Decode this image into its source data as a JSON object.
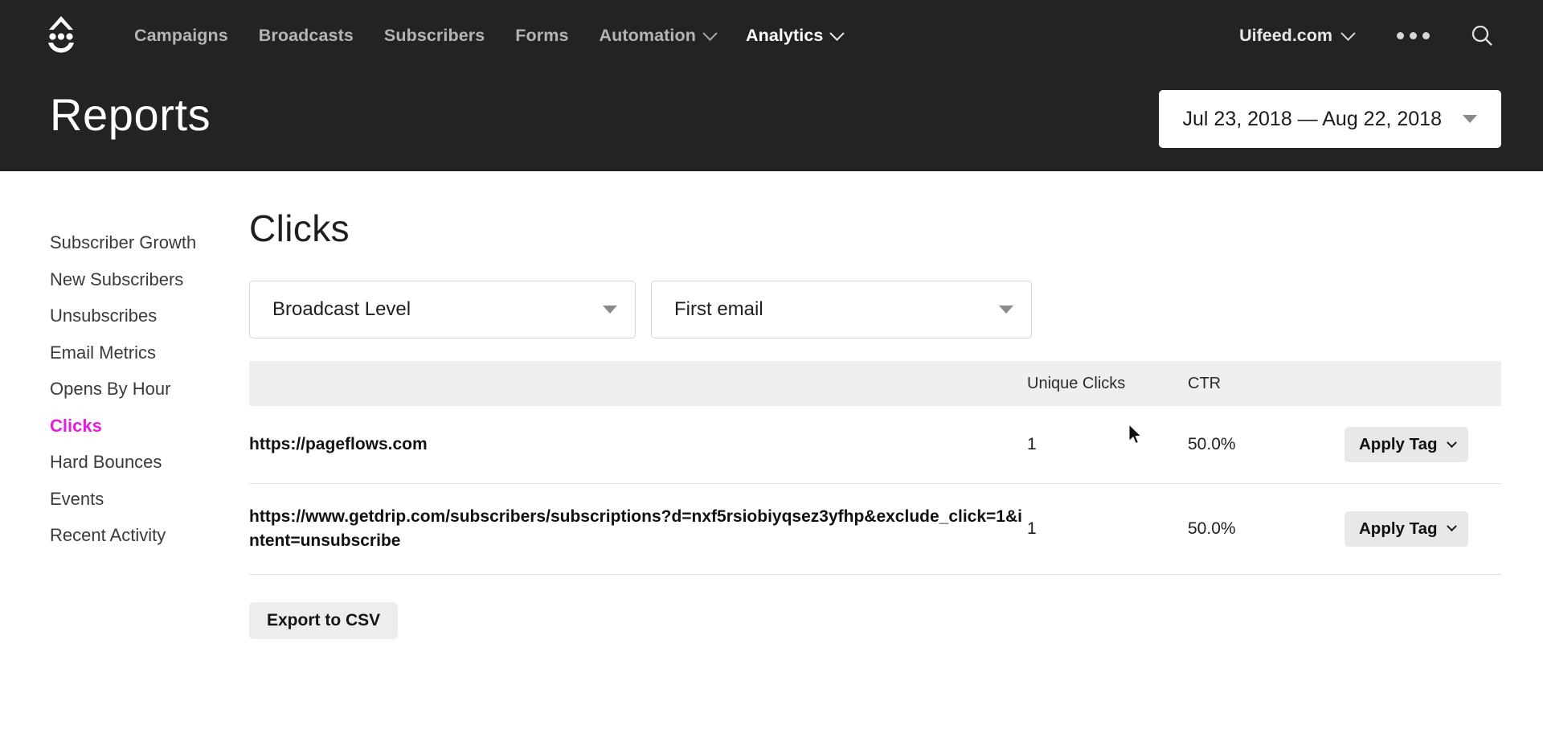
{
  "header": {
    "logo_name": "drip-logo",
    "nav": [
      {
        "label": "Campaigns",
        "has_caret": false,
        "active": false
      },
      {
        "label": "Broadcasts",
        "has_caret": false,
        "active": false
      },
      {
        "label": "Subscribers",
        "has_caret": false,
        "active": false
      },
      {
        "label": "Forms",
        "has_caret": false,
        "active": false
      },
      {
        "label": "Automation",
        "has_caret": true,
        "active": false
      },
      {
        "label": "Analytics",
        "has_caret": true,
        "active": true
      }
    ],
    "account_label": "Uifeed.com",
    "more_menu_icon": "ellipsis-icon",
    "search_icon": "search-icon"
  },
  "page": {
    "title": "Reports",
    "date_range": "Jul 23, 2018 — Aug 22, 2018"
  },
  "sidebar": {
    "items": [
      {
        "label": "Subscriber Growth",
        "active": false
      },
      {
        "label": "New Subscribers",
        "active": false
      },
      {
        "label": "Unsubscribes",
        "active": false
      },
      {
        "label": "Email Metrics",
        "active": false
      },
      {
        "label": "Opens By Hour",
        "active": false
      },
      {
        "label": "Clicks",
        "active": true
      },
      {
        "label": "Hard Bounces",
        "active": false
      },
      {
        "label": "Events",
        "active": false
      },
      {
        "label": "Recent Activity",
        "active": false
      }
    ]
  },
  "main": {
    "section_title": "Clicks",
    "filters": [
      {
        "name": "level-select",
        "value": "Broadcast Level"
      },
      {
        "name": "email-select",
        "value": "First email"
      }
    ],
    "table": {
      "columns": [
        "",
        "Unique Clicks",
        "CTR",
        ""
      ],
      "rows": [
        {
          "url": "https://pageflows.com",
          "unique_clicks": "1",
          "ctr": "50.0%",
          "tag_label": "Apply Tag"
        },
        {
          "url": "https://www.getdrip.com/subscribers/subscriptions?d=nxf5rsiobiyqsez3yfhp&exclude_click=1&intent=unsubscribe",
          "unique_clicks": "1",
          "ctr": "50.0%",
          "tag_label": "Apply Tag"
        }
      ]
    },
    "export_label": "Export to CSV"
  },
  "colors": {
    "header_bg": "#232323",
    "active_accent": "#e81ce0",
    "table_header_bg": "#efefef",
    "button_bg": "#e8e8e8"
  }
}
